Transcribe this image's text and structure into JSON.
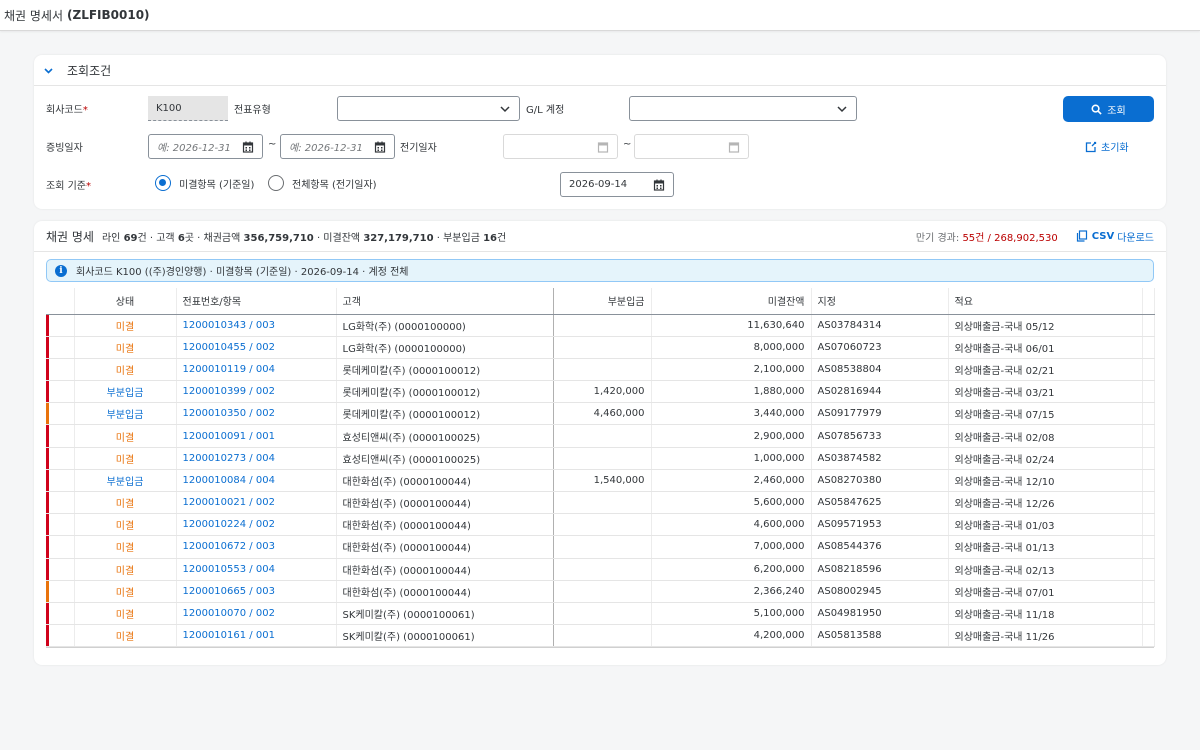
{
  "app": {
    "title_prefix": "채권 명세서",
    "title_code": "(ZLFIB0010)"
  },
  "filter": {
    "header": "조회조건",
    "company_label": "회사코드",
    "company_value": "K100",
    "doc_type_label": "전표유형",
    "gl_label": "G/L 계정",
    "evidence_date_label": "증빙일자",
    "date_placeholder": "예: 2026-12-31",
    "tilde": "~",
    "posting_date_label": "전기일자",
    "basis_label": "조회 기준",
    "radio_open": "미결항목 (기준일)",
    "radio_all": "전체항목 (전기일자)",
    "basis_date": "2026-09-14",
    "search_button": "조회",
    "reset_button": "초기화",
    "required_mark": "*"
  },
  "list": {
    "title": "채권 명세",
    "stat_line_label": "라인",
    "stat_line_value": "69",
    "stat_line_unit": "건 · 고객",
    "stat_cust_value": "6",
    "stat_cust_unit": "곳 · 채권금액",
    "stat_amount_value": "356,759,710",
    "stat_open_label": "· 미결잔액",
    "stat_open_value": "327,179,710",
    "stat_part_label": "· 부분입금",
    "stat_part_value": "16",
    "stat_part_unit": "건",
    "overdue_label": "만기 경과:",
    "overdue_value": "55건 / 268,902,530",
    "csv_label_bold": "CSV",
    "csv_label": "다운로드",
    "info": "회사코드 K100 ((주)경인양행) · 미결항목 (기준일) · 2026-09-14 · 계정 전체"
  },
  "columns": [
    "상태",
    "전표번호/항목",
    "고객",
    "부분입금",
    "미결잔액",
    "지정",
    "적요"
  ],
  "colors": {
    "accent": "#0a6ed1",
    "overdue_red": "#d0021b",
    "overdue_orange": "#e9730c"
  },
  "rows": [
    {
      "ind": "red",
      "status": "미결",
      "status_type": "open",
      "doc": "1200010343 / 003",
      "customer": "LG화학(주) (0000100000)",
      "partial": "",
      "open": "11,630,640",
      "assign": "AS03784314",
      "text": "외상매출금-국내 05/12"
    },
    {
      "ind": "red",
      "status": "미결",
      "status_type": "open",
      "doc": "1200010455 / 002",
      "customer": "LG화학(주) (0000100000)",
      "partial": "",
      "open": "8,000,000",
      "assign": "AS07060723",
      "text": "외상매출금-국내 06/01"
    },
    {
      "ind": "red",
      "status": "미결",
      "status_type": "open",
      "doc": "1200010119 / 004",
      "customer": "롯데케미칼(주) (0000100012)",
      "partial": "",
      "open": "2,100,000",
      "assign": "AS08538804",
      "text": "외상매출금-국내 02/21"
    },
    {
      "ind": "red",
      "status": "부분입금",
      "status_type": "part",
      "doc": "1200010399 / 002",
      "customer": "롯데케미칼(주) (0000100012)",
      "partial": "1,420,000",
      "open": "1,880,000",
      "assign": "AS02816944",
      "text": "외상매출금-국내 03/21"
    },
    {
      "ind": "orange",
      "status": "부분입금",
      "status_type": "part",
      "doc": "1200010350 / 002",
      "customer": "롯데케미칼(주) (0000100012)",
      "partial": "4,460,000",
      "open": "3,440,000",
      "assign": "AS09177979",
      "text": "외상매출금-국내 07/15"
    },
    {
      "ind": "red",
      "status": "미결",
      "status_type": "open",
      "doc": "1200010091 / 001",
      "customer": "효성티앤씨(주) (0000100025)",
      "partial": "",
      "open": "2,900,000",
      "assign": "AS07856733",
      "text": "외상매출금-국내 02/08"
    },
    {
      "ind": "red",
      "status": "미결",
      "status_type": "open",
      "doc": "1200010273 / 004",
      "customer": "효성티앤씨(주) (0000100025)",
      "partial": "",
      "open": "1,000,000",
      "assign": "AS03874582",
      "text": "외상매출금-국내 02/24"
    },
    {
      "ind": "red",
      "status": "부분입금",
      "status_type": "part",
      "doc": "1200010084 / 004",
      "customer": "대한화섬(주) (0000100044)",
      "partial": "1,540,000",
      "open": "2,460,000",
      "assign": "AS08270380",
      "text": "외상매출금-국내 12/10"
    },
    {
      "ind": "red",
      "status": "미결",
      "status_type": "open",
      "doc": "1200010021 / 002",
      "customer": "대한화섬(주) (0000100044)",
      "partial": "",
      "open": "5,600,000",
      "assign": "AS05847625",
      "text": "외상매출금-국내 12/26"
    },
    {
      "ind": "red",
      "status": "미결",
      "status_type": "open",
      "doc": "1200010224 / 002",
      "customer": "대한화섬(주) (0000100044)",
      "partial": "",
      "open": "4,600,000",
      "assign": "AS09571953",
      "text": "외상매출금-국내 01/03"
    },
    {
      "ind": "red",
      "status": "미결",
      "status_type": "open",
      "doc": "1200010672 / 003",
      "customer": "대한화섬(주) (0000100044)",
      "partial": "",
      "open": "7,000,000",
      "assign": "AS08544376",
      "text": "외상매출금-국내 01/13"
    },
    {
      "ind": "red",
      "status": "미결",
      "status_type": "open",
      "doc": "1200010553 / 004",
      "customer": "대한화섬(주) (0000100044)",
      "partial": "",
      "open": "6,200,000",
      "assign": "AS08218596",
      "text": "외상매출금-국내 02/13"
    },
    {
      "ind": "orange",
      "status": "미결",
      "status_type": "open",
      "doc": "1200010665 / 003",
      "customer": "대한화섬(주) (0000100044)",
      "partial": "",
      "open": "2,366,240",
      "assign": "AS08002945",
      "text": "외상매출금-국내 07/01"
    },
    {
      "ind": "red",
      "status": "미결",
      "status_type": "open",
      "doc": "1200010070 / 002",
      "customer": "SK케미칼(주) (0000100061)",
      "partial": "",
      "open": "5,100,000",
      "assign": "AS04981950",
      "text": "외상매출금-국내 11/18"
    },
    {
      "ind": "red",
      "status": "미결",
      "status_type": "open",
      "doc": "1200010161 / 001",
      "customer": "SK케미칼(주) (0000100061)",
      "partial": "",
      "open": "4,200,000",
      "assign": "AS05813588",
      "text": "외상매출금-국내 11/26"
    }
  ]
}
